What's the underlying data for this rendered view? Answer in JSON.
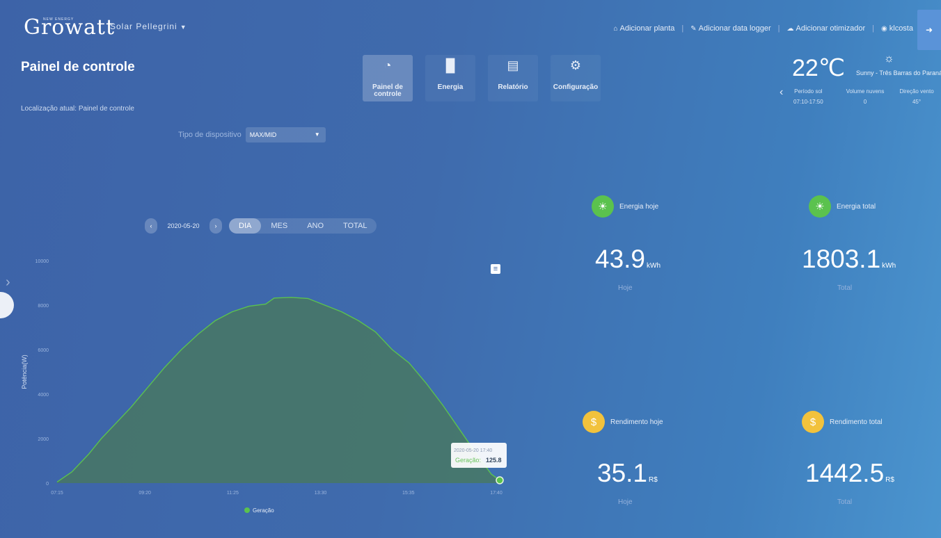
{
  "header": {
    "logo_text": "Growatt",
    "logo_tagline": "NEW ENERGY",
    "plant_name": "Solar Pellegrini",
    "links": [
      {
        "label": "Adicionar planta",
        "icon": "home-icon"
      },
      {
        "label": "Adicionar data logger",
        "icon": "edit-icon"
      },
      {
        "label": "Adicionar otimizador",
        "icon": "cloud-icon"
      },
      {
        "label": "klcosta",
        "icon": "user-icon"
      }
    ]
  },
  "page": {
    "title": "Painel de controle",
    "location": "Localização atual: Painel de controle"
  },
  "nav": {
    "tabs": [
      {
        "label": "Painel de controle",
        "icon": "gauge-icon",
        "active": true
      },
      {
        "label": "Energia",
        "icon": "bar-chart-icon",
        "active": false
      },
      {
        "label": "Relatório",
        "icon": "report-icon",
        "active": false
      },
      {
        "label": "Configuração",
        "icon": "gear-icon",
        "active": false
      }
    ]
  },
  "weather": {
    "temp": "22℃",
    "condition": "Sunny - Três Barras do Paraná",
    "columns": [
      {
        "label": "Período sol",
        "value": "07:10-17:50"
      },
      {
        "label": "Volume nuvens",
        "value": "0"
      },
      {
        "label": "Direção vento",
        "value": "45°"
      }
    ]
  },
  "device": {
    "label": "Tipo de dispositivo",
    "value": "MAX/MID"
  },
  "period": {
    "date": "2020-05-20",
    "tabs": [
      "DIA",
      "MES",
      "ANO",
      "TOTAL"
    ],
    "active": "DIA"
  },
  "chart_data": {
    "type": "area",
    "ylabel": "Potência(W)",
    "ylim": [
      0,
      10000
    ],
    "yticks": [
      0,
      2000,
      4000,
      6000,
      8000,
      10000
    ],
    "xticks": [
      "07:15",
      "09:20",
      "11:25",
      "13:30",
      "15:35",
      "17:40"
    ],
    "series": [
      {
        "name": "Geração",
        "color": "#5bc24e",
        "x": [
          7.25,
          7.6,
          8.0,
          8.3,
          8.6,
          9.0,
          9.4,
          9.8,
          10.2,
          10.6,
          11.0,
          11.4,
          11.8,
          12.2,
          12.4,
          12.8,
          13.2,
          13.6,
          14.0,
          14.4,
          14.8,
          15.2,
          15.6,
          16.0,
          16.4,
          16.8,
          17.2,
          17.55,
          17.75
        ],
        "y": [
          50,
          500,
          1300,
          2000,
          2600,
          3400,
          4300,
          5200,
          6000,
          6700,
          7300,
          7700,
          7950,
          8050,
          8320,
          8350,
          8300,
          8000,
          7700,
          7300,
          6800,
          6000,
          5400,
          4500,
          3500,
          2400,
          1300,
          400,
          125.8
        ]
      }
    ],
    "tooltip": {
      "time": "2020-05-20 17:40",
      "label": "Geração",
      "value": "125.8"
    },
    "legend": "bottom"
  },
  "stats": {
    "energy_today": {
      "title": "Energia hoje",
      "value": "43.9",
      "unit": "kWh",
      "sub": "Hoje"
    },
    "energy_total": {
      "title": "Energia total",
      "value": "1803.1",
      "unit": "kWh",
      "sub": "Total"
    },
    "yield_today": {
      "title": "Rendimento hoje",
      "value": "35.1",
      "unit": "R$",
      "sub": "Hoje"
    },
    "yield_total": {
      "title": "Rendimento total",
      "value": "1442.5",
      "unit": "R$",
      "sub": "Total"
    }
  }
}
